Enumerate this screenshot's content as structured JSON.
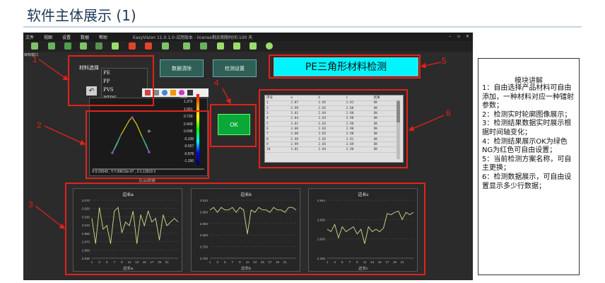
{
  "slide": {
    "title": "软件主体展示 (1)"
  },
  "app": {
    "menu": [
      "文件",
      "视图",
      "设置",
      "数据",
      "帮助"
    ],
    "title_bar": "EasyVision 11.0.1.0-试用版本 - license剩余期限时间:100 天",
    "window_label": "目标窗口"
  },
  "material": {
    "label": "材料选择",
    "options": [
      "PE",
      "PP",
      "PVS",
      "PTPE"
    ]
  },
  "buttons": {
    "clear": "数据清除",
    "settings": "检测设置"
  },
  "scheme_name": "PE三角形材料检测",
  "result": "OK",
  "image_panel": {
    "colorbar_title": "高度",
    "colorbar_ticks": [
      "1.372",
      "1.051",
      "0.730",
      "0.409",
      "0.098",
      "-0.235",
      "-0.557",
      "-0.878",
      "-1.200"
    ],
    "status": "X:9.23543 , Y:7.09613e-07 , Z:1.13519   2",
    "caption": "点云图像"
  },
  "table": {
    "headers": [
      "序号",
      "a",
      "b",
      "c",
      "结果"
    ],
    "rows": [
      [
        "1",
        "2.87",
        "2.85",
        "2.81",
        "OK"
      ],
      [
        "2",
        "2.99",
        "2.85",
        "2.88",
        "OK"
      ],
      [
        "3",
        "3.01",
        "2.84",
        "2.88",
        "OK"
      ],
      [
        "4",
        "2.84",
        "2.83",
        "2.90",
        "OK"
      ],
      [
        "5",
        "3.01",
        "2.83",
        "2.90",
        "OK"
      ],
      [
        "6",
        "3.00",
        "2.83",
        "2.90",
        "OK"
      ],
      [
        "7",
        "3.00",
        "2.85",
        "2.90",
        "OK"
      ],
      [
        "8",
        "2.99",
        "2.85",
        "2.91",
        "OK"
      ],
      [
        "9",
        "2.99",
        "2.85",
        "2.89",
        "OK"
      ],
      [
        "10",
        "3.01",
        "2.84",
        "2.90",
        "OK"
      ]
    ]
  },
  "charts": [
    {
      "title": "边长a",
      "xlabel": "边长a",
      "yticks": [
        "3.070",
        "3.050",
        "3.030",
        "3.010",
        "2.990",
        "2.970",
        "2.950",
        "2.930"
      ],
      "values": [
        3.03,
        2.96,
        3.06,
        3.0,
        3.01,
        2.96,
        3.05,
        3.06,
        2.99,
        3.02,
        3.01,
        3.05,
        2.96,
        3.04,
        3.01,
        3.05,
        3.02,
        3.03,
        2.97,
        3.04,
        3.01,
        3.02,
        3.03,
        3.02
      ],
      "ymin": 2.92,
      "ymax": 3.08
    },
    {
      "title": "边长b",
      "xlabel": "边长b",
      "yticks": [
        "2.910",
        "2.900",
        "2.850",
        "2.800",
        "2.750",
        "2.700"
      ],
      "values": [
        2.88,
        2.89,
        2.87,
        2.89,
        2.88,
        2.88,
        2.89,
        2.87,
        2.89,
        2.88,
        2.78,
        2.88,
        2.87,
        2.89,
        2.88,
        2.88,
        2.87,
        2.89,
        2.88,
        2.88,
        2.87,
        2.89,
        2.89,
        2.88
      ],
      "ymin": 2.68,
      "ymax": 2.92
    },
    {
      "title": "边长c",
      "xlabel": "边长c",
      "yticks": [
        "2.844",
        "2.600",
        "2.600",
        "2.400"
      ],
      "values": [
        2.62,
        2.6,
        2.66,
        2.55,
        2.64,
        2.6,
        2.62,
        2.64,
        2.58,
        2.62,
        2.5,
        2.64,
        2.6,
        2.62,
        2.6,
        2.63,
        2.75,
        2.74,
        2.76,
        2.77,
        2.7,
        2.76,
        2.74,
        2.76
      ],
      "ymin": 2.38,
      "ymax": 2.86
    }
  ],
  "chart_xticks": [
    "1",
    "3",
    "5",
    "7",
    "9",
    "11",
    "13",
    "15",
    "17",
    "19",
    "21"
  ],
  "callouts": [
    "1",
    "2",
    "3",
    "4",
    "5",
    "6"
  ],
  "explain": {
    "title": "模块讲解",
    "lines": [
      "1：自由选择产品材料可自由添加，一种材料对应一种镭射参数；",
      "2：检测实时轮廓图像展示；",
      "3：检测结果数据实时展示根据时间轴变化；",
      "4：检测结果展示OK为绿色NG为红色可自由设置；",
      "5：当前检测方案名称，可自主更换；",
      "6：检测数据展示，可自由设置显示多少行数据；"
    ]
  },
  "colors": {
    "callout": "#e0221b",
    "ok": "#0aa838",
    "scheme_bg": "#00f5ff",
    "line": "#cfe08a"
  }
}
